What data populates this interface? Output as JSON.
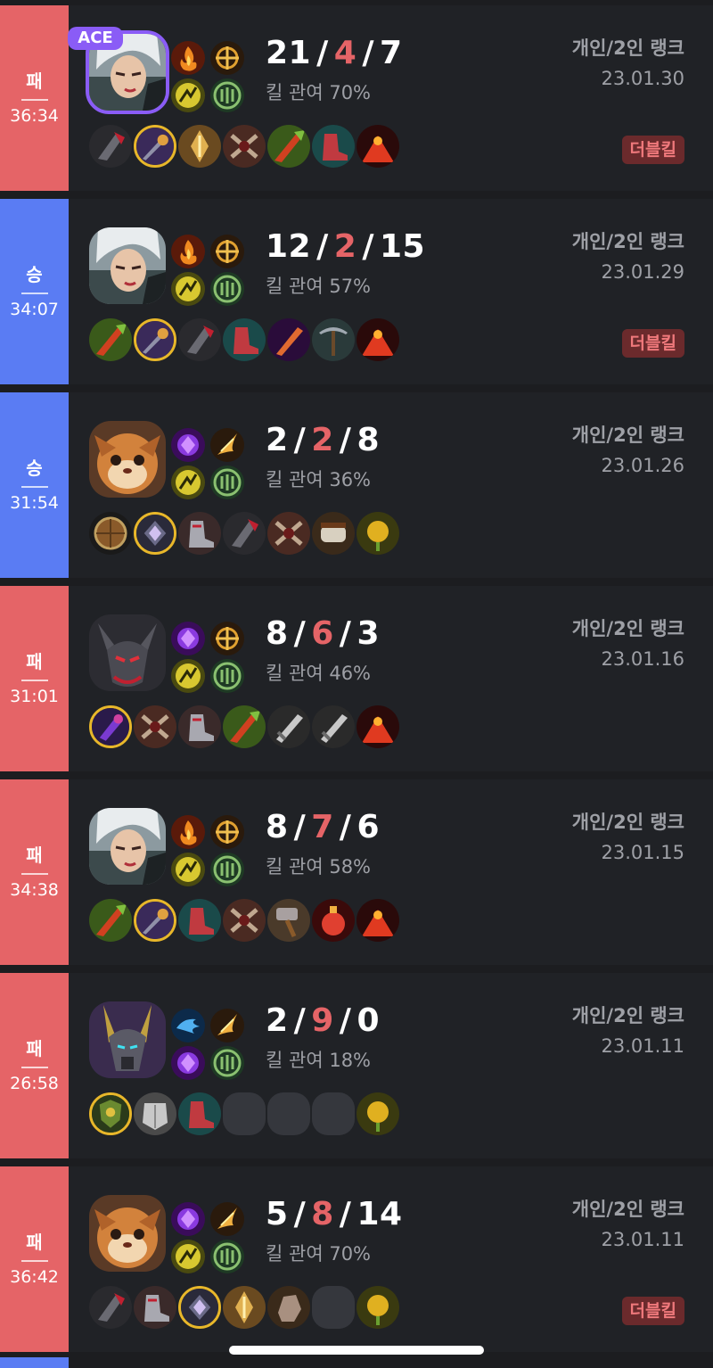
{
  "colors": {
    "background": "#1c1d20",
    "card": "#202226",
    "loss": "#e56467",
    "win": "#5a7cf3",
    "ace": "#8a5cf6",
    "deaths": "#e56467",
    "muted_text": "#9ea0a6",
    "multikill_bg": "#6b2a2c",
    "multikill_text": "#f0797c",
    "active_item_border": "#e8b72a"
  },
  "ace_label": "ACE",
  "kp_prefix": "킬 관여",
  "matches": [
    {
      "result": "패",
      "outcome": "loss",
      "duration": "36:34",
      "ace": true,
      "champion_icon": "riven-icon",
      "spells": [
        "ignite-icon",
        "teleport-icon"
      ],
      "runes": [
        "fleet-footwork-icon",
        "resolve-icon"
      ],
      "kills": "21",
      "deaths": "4",
      "assists": "7",
      "kill_participation": "70%",
      "queue": "개인/2인 랭크",
      "date": "23.01.30",
      "multikill": "더블킬",
      "items": [
        "black-cleaver-icon",
        "eclipse-icon",
        "sterak-icon",
        "death-dance-icon",
        "ravenous-hydra-icon",
        "plated-steelcaps-icon",
        "oracle-lens-icon"
      ],
      "active_item": 1
    },
    {
      "result": "승",
      "outcome": "win",
      "duration": "34:07",
      "ace": false,
      "champion_icon": "riven-icon",
      "spells": [
        "ignite-icon",
        "teleport-icon"
      ],
      "runes": [
        "fleet-footwork-icon",
        "resolve-icon"
      ],
      "kills": "12",
      "deaths": "2",
      "assists": "15",
      "kill_participation": "57%",
      "queue": "개인/2인 랭크",
      "date": "23.01.29",
      "multikill": "더블킬",
      "items": [
        "ravenous-hydra-icon",
        "eclipse-icon",
        "black-cleaver-icon",
        "plated-steelcaps-icon",
        "serrated-dirk-icon",
        "pickaxe-icon",
        "oracle-lens-icon"
      ],
      "active_item": 1
    },
    {
      "result": "승",
      "outcome": "win",
      "duration": "31:54",
      "ace": false,
      "champion_icon": "gnar-icon",
      "spells": [
        "mythic-shard-icon",
        "flash-icon"
      ],
      "runes": [
        "fleet-footwork-icon",
        "resolve-icon"
      ],
      "kills": "2",
      "deaths": "2",
      "assists": "8",
      "kill_participation": "36%",
      "queue": "개인/2인 랭크",
      "date": "23.01.26",
      "multikill": "",
      "items": [
        "shield-icon",
        "divine-sunderer-icon",
        "mercury-treads-icon",
        "black-cleaver-icon",
        "death-dance-icon",
        "gauntlet-icon",
        "stealth-ward-icon"
      ],
      "active_item": 1
    },
    {
      "result": "패",
      "outcome": "loss",
      "duration": "31:01",
      "ace": false,
      "champion_icon": "aatrox-icon",
      "spells": [
        "mythic-shard-icon",
        "teleport-icon"
      ],
      "runes": [
        "fleet-footwork-icon",
        "resolve-icon"
      ],
      "kills": "8",
      "deaths": "6",
      "assists": "3",
      "kill_participation": "46%",
      "queue": "개인/2인 랭크",
      "date": "23.01.16",
      "multikill": "",
      "items": [
        "goredrinker-icon",
        "death-dance-icon",
        "mercury-treads-icon",
        "ravenous-hydra-icon",
        "long-sword-icon",
        "long-sword-icon",
        "oracle-lens-icon"
      ],
      "active_item": 0
    },
    {
      "result": "패",
      "outcome": "loss",
      "duration": "34:38",
      "ace": false,
      "champion_icon": "riven-icon",
      "spells": [
        "ignite-icon",
        "teleport-icon"
      ],
      "runes": [
        "fleet-footwork-icon",
        "resolve-icon"
      ],
      "kills": "8",
      "deaths": "7",
      "assists": "6",
      "kill_participation": "58%",
      "queue": "개인/2인 랭크",
      "date": "23.01.15",
      "multikill": "",
      "items": [
        "ravenous-hydra-icon",
        "eclipse-icon",
        "plated-steelcaps-icon",
        "death-dance-icon",
        "hammer-icon",
        "red-potion-icon",
        "oracle-lens-icon"
      ],
      "active_item": 1
    },
    {
      "result": "패",
      "outcome": "loss",
      "duration": "26:58",
      "ace": false,
      "champion_icon": "nasus-icon",
      "spells": [
        "ghost-icon",
        "flash-icon"
      ],
      "runes": [
        "mythic-shard-icon",
        "resolve-icon"
      ],
      "kills": "2",
      "deaths": "9",
      "assists": "0",
      "kill_participation": "18%",
      "queue": "개인/2인 랭크",
      "date": "23.01.11",
      "multikill": "",
      "items": [
        "relic-shield-icon",
        "armor-icon",
        "plated-steelcaps-icon",
        "",
        "",
        "",
        "stealth-ward-icon"
      ],
      "active_item": 0
    },
    {
      "result": "패",
      "outcome": "loss",
      "duration": "36:42",
      "ace": false,
      "champion_icon": "gnar-icon",
      "spells": [
        "mythic-shard-icon",
        "flash-icon"
      ],
      "runes": [
        "fleet-footwork-icon",
        "resolve-icon"
      ],
      "kills": "5",
      "deaths": "8",
      "assists": "14",
      "kill_participation": "70%",
      "queue": "개인/2인 랭크",
      "date": "23.01.11",
      "multikill": "더블킬",
      "items": [
        "black-cleaver-icon",
        "mercury-treads-icon",
        "divine-sunderer-icon",
        "sterak-icon",
        "rock-icon",
        "",
        "stealth-ward-icon"
      ],
      "active_item": 2
    }
  ]
}
